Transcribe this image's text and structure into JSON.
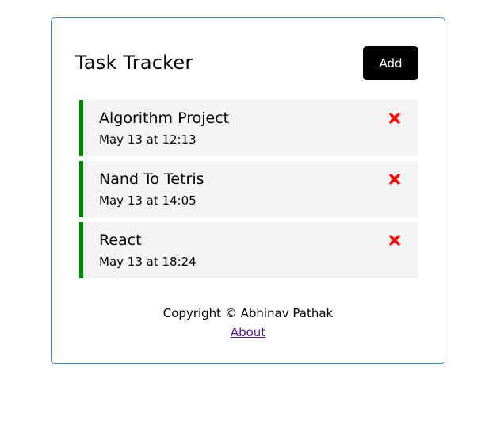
{
  "header": {
    "title": "Task Tracker",
    "add_label": "Add"
  },
  "tasks": [
    {
      "name": "Algorithm Project",
      "time": "May 13 at 12:13",
      "delete_icon": "close-icon"
    },
    {
      "name": "Nand To Tetris",
      "time": "May 13 at 14:05",
      "delete_icon": "close-icon"
    },
    {
      "name": "React",
      "time": "May 13 at 18:24",
      "delete_icon": "close-icon"
    }
  ],
  "footer": {
    "copyright": "Copyright © Abhinav Pathak",
    "about_label": "About"
  },
  "colors": {
    "container_border": "#4682b4",
    "button_bg": "#000000",
    "task_bg": "#f4f4f4",
    "task_reminder_border": "#008000",
    "delete_icon": "#ff0000",
    "link": "#551a8b"
  }
}
